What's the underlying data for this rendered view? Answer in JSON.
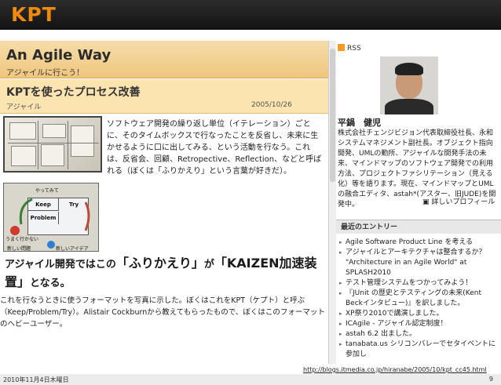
{
  "slide": {
    "title": "KPT",
    "footer_date": "2010年11月4日木曜日",
    "page_number": "9",
    "url": "http://blogs.itmedia.co.jp/hiranabe/2005/10/kpt_cc45.html"
  },
  "blog": {
    "title": "An Agile Way",
    "subtitle": "アジャイルに行こう！",
    "rss": "RSS"
  },
  "post": {
    "title": "KPTを使ったプロセス改善",
    "category": "アジャイル",
    "date": "2005/10/26",
    "body": "ソフトウェア開発の繰り返し単位（イテレーション）ごとに、そのタイムボックスで行なったことを反省し、未来に生かせるように口に出してみる、という活動を行なう。これは、反省会、回顧、Retropective、Reflection、などと呼ばれる（ぼくは「ふりかえり」という言葉が好きだ）。",
    "diagram": {
      "keep": "Keep",
      "try": "Try",
      "problem": "Problem",
      "cap_top": "やってみて",
      "cap_left": "うまく行かない",
      "cap_bottom_left": "新しい問題",
      "cap_bottom_right": "新しいアイデア"
    },
    "quote_part1": "アジャイル開発ではこの",
    "quote_em1": "「ふりかえり」",
    "quote_part2": "が",
    "quote_em2": "「KAIZEN加速装置」",
    "quote_part3": "となる。",
    "bottom_text": "これを行なうときに使うフォーマットを写真に示した。ぼくはこれをKPT（ケプト）と呼ぶ（Keep/Problem/Try）。Alistair Cockburnから教えてもらったもので、ぼくはこのフォーマットのヘビーユーザー。"
  },
  "author": {
    "name": "平鍋　健児",
    "bio": "株式会社チェンジビジョン代表取締役社長、永和システムマネジメント副社長。オブジェクト指向開発、UMLの勤所、アジャイルな開発手法の未来、マインドマップのソフトウェア開発での利用方法、プロジェクトファシリテーション（見える化）等を語ります。現在、マインドマップとUMLの融合エディタ、astah*(アスター、旧JUDE)を開発中。",
    "profile_link": "詳しいプロフィール"
  },
  "recent": {
    "heading": "最近のエントリー",
    "entries": [
      "Agile Software Product Line を考える",
      "アジャイルとアーキテクチャは整合するか？ \"Architecture in an Agile World\" at SPLASH2010",
      "テスト管理システムをつかってみよう！",
      "『JUnit の歴史とテスティングの未来(Kent Beckインタビュー)』を訳しました。",
      "XP祭り2010で講演しました。",
      "ICAgile - アジャイル認定制度！",
      "astah 6.2 出ました。",
      "tanabata.us シリコンバレーでセタイベントに参加し"
    ]
  },
  "colors": {
    "header_bg": "#1a1a1a",
    "title_orange": "#f08a0c",
    "banner": "#efc67e"
  }
}
